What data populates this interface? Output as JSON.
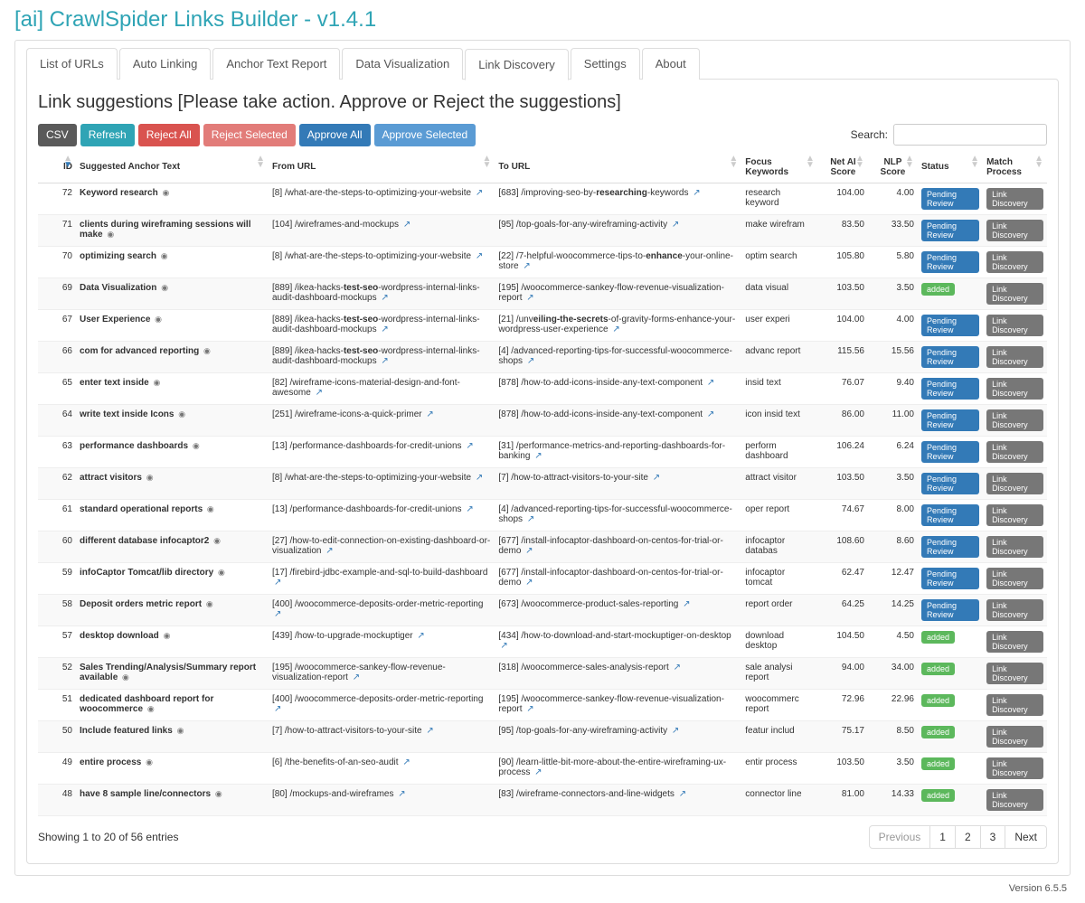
{
  "app_title": "[ai] CrawlSpider Links Builder - v1.4.1",
  "version": "Version 6.5.5",
  "tabs": [
    "List of URLs",
    "Auto Linking",
    "Anchor Text Report",
    "Data Visualization",
    "Link Discovery",
    "Settings",
    "About"
  ],
  "active_tab": 4,
  "panel_heading": "Link suggestions [Please take action. Approve or Reject the suggestions]",
  "buttons": {
    "csv": "CSV",
    "refresh": "Refresh",
    "reject_all": "Reject All",
    "reject_sel": "Reject Selected",
    "approve_all": "Approve All",
    "approve_sel": "Approve Selected"
  },
  "search_label": "Search:",
  "search_value": "",
  "columns": [
    "ID",
    "Suggested Anchor Text",
    "From URL",
    "To URL",
    "Focus Keywords",
    "Net AI Score",
    "NLP Score",
    "Status",
    "Match Process"
  ],
  "status_labels": {
    "pending": "Pending Review",
    "added": "added"
  },
  "match_label": "Link Discovery",
  "rows": [
    {
      "id": 72,
      "anchor": "Keyword research",
      "from_pre": "[8] /what-are-the-steps-to-optimizing-your-website",
      "from_bold": "",
      "to_pre": "[683] /improving-seo-by-",
      "to_bold": "researching",
      "to_post": "-keywords",
      "kw": "research keyword",
      "net": "104.00",
      "nlp": "4.00",
      "status": "pending"
    },
    {
      "id": 71,
      "anchor": "clients during wireframing sessions will make",
      "from_pre": "[104] /wireframes-and-mockups",
      "from_bold": "",
      "to_pre": "[95] /top-goals-for-any-wireframing-activity",
      "to_bold": "",
      "to_post": "",
      "kw": "make wirefram",
      "net": "83.50",
      "nlp": "33.50",
      "status": "pending"
    },
    {
      "id": 70,
      "anchor": "optimizing search",
      "from_pre": "[8] /what-are-the-steps-to-optimizing-your-website",
      "from_bold": "",
      "to_pre": "[22] /7-helpful-woocommerce-tips-to-",
      "to_bold": "enhance",
      "to_post": "-your-online-store",
      "kw": "optim search",
      "net": "105.80",
      "nlp": "5.80",
      "status": "pending"
    },
    {
      "id": 69,
      "anchor": "Data Visualization",
      "from_pre": "[889] /ikea-hacks-",
      "from_bold": "test-seo",
      "from_post": "-wordpress-internal-links-audit-dashboard-mockups",
      "to_pre": "[195] /woocommerce-sankey-flow-revenue-visualization-report",
      "to_bold": "",
      "to_post": "",
      "kw": "data visual",
      "net": "103.50",
      "nlp": "3.50",
      "status": "added"
    },
    {
      "id": 67,
      "anchor": "User Experience",
      "from_pre": "[889] /ikea-hacks-",
      "from_bold": "test-seo",
      "from_post": "-wordpress-internal-links-audit-dashboard-mockups",
      "to_pre": "[21] /unv",
      "to_bold": "eiling-the-secrets",
      "to_post": "-of-gravity-forms-enhance-your-wordpress-user-experience",
      "kw": "user experi",
      "net": "104.00",
      "nlp": "4.00",
      "status": "pending"
    },
    {
      "id": 66,
      "anchor": "com for advanced reporting",
      "from_pre": "[889] /ikea-hacks-",
      "from_bold": "test-seo",
      "from_post": "-wordpress-internal-links-audit-dashboard-mockups",
      "to_pre": "[4] /advanced-reporting-tips-for-successful-woocommerce-shops",
      "to_bold": "",
      "to_post": "",
      "kw": "advanc report",
      "net": "115.56",
      "nlp": "15.56",
      "status": "pending"
    },
    {
      "id": 65,
      "anchor": "enter text inside",
      "from_pre": "[82] /wireframe-icons-material-design-and-font-awesome",
      "from_bold": "",
      "to_pre": "[878] /how-to-add-icons-inside-any-text-component",
      "to_bold": "",
      "to_post": "",
      "kw": "insid text",
      "net": "76.07",
      "nlp": "9.40",
      "status": "pending"
    },
    {
      "id": 64,
      "anchor": "write text inside Icons",
      "from_pre": "[251] /wireframe-icons-a-quick-primer",
      "from_bold": "",
      "to_pre": "[878] /how-to-add-icons-inside-any-text-component",
      "to_bold": "",
      "to_post": "",
      "kw": "icon insid text",
      "net": "86.00",
      "nlp": "11.00",
      "status": "pending"
    },
    {
      "id": 63,
      "anchor": "performance dashboards",
      "from_pre": "[13] /performance-dashboards-for-credit-unions",
      "from_bold": "",
      "to_pre": "[31] /performance-metrics-and-reporting-dashboards-for-banking",
      "to_bold": "",
      "to_post": "",
      "kw": "perform dashboard",
      "net": "106.24",
      "nlp": "6.24",
      "status": "pending"
    },
    {
      "id": 62,
      "anchor": "attract visitors",
      "from_pre": "[8] /what-are-the-steps-to-optimizing-your-website",
      "from_bold": "",
      "to_pre": "[7] /how-to-attract-visitors-to-your-site",
      "to_bold": "",
      "to_post": "",
      "kw": "attract visitor",
      "net": "103.50",
      "nlp": "3.50",
      "status": "pending"
    },
    {
      "id": 61,
      "anchor": "standard operational reports",
      "from_pre": "[13] /performance-dashboards-for-credit-unions",
      "from_bold": "",
      "to_pre": "[4] /advanced-reporting-tips-for-successful-woocommerce-shops",
      "to_bold": "",
      "to_post": "",
      "kw": "oper report",
      "net": "74.67",
      "nlp": "8.00",
      "status": "pending"
    },
    {
      "id": 60,
      "anchor": "different database infocaptor2",
      "from_pre": "[27] /how-to-edit-connection-on-existing-dashboard-or-visualization",
      "from_bold": "",
      "to_pre": "[677] /install-infocaptor-dashboard-on-centos-for-trial-or-demo",
      "to_bold": "",
      "to_post": "",
      "kw": "infocaptor databas",
      "net": "108.60",
      "nlp": "8.60",
      "status": "pending"
    },
    {
      "id": 59,
      "anchor": "infoCaptor Tomcat/lib directory",
      "from_pre": "[17] /firebird-jdbc-example-and-sql-to-build-dashboard",
      "from_bold": "",
      "to_pre": "[677] /install-infocaptor-dashboard-on-centos-for-trial-or-demo",
      "to_bold": "",
      "to_post": "",
      "kw": "infocaptor tomcat",
      "net": "62.47",
      "nlp": "12.47",
      "status": "pending"
    },
    {
      "id": 58,
      "anchor": "Deposit orders metric report",
      "from_pre": "[400] /woocommerce-deposits-order-metric-reporting",
      "from_bold": "",
      "to_pre": "[673] /woocommerce-product-sales-reporting",
      "to_bold": "",
      "to_post": "",
      "kw": "report order",
      "net": "64.25",
      "nlp": "14.25",
      "status": "pending"
    },
    {
      "id": 57,
      "anchor": "desktop download",
      "from_pre": "[439] /how-to-upgrade-mockuptiger",
      "from_bold": "",
      "to_pre": "[434] /how-to-download-and-start-mockuptiger-on-desktop",
      "to_bold": "",
      "to_post": "",
      "kw": "download desktop",
      "net": "104.50",
      "nlp": "4.50",
      "status": "added"
    },
    {
      "id": 52,
      "anchor": "Sales Trending/Analysis/Summary report available",
      "from_pre": "[195] /woocommerce-sankey-flow-revenue-visualization-report",
      "from_bold": "",
      "to_pre": "[318] /woocommerce-sales-analysis-report",
      "to_bold": "",
      "to_post": "",
      "kw": "sale analysi report",
      "net": "94.00",
      "nlp": "34.00",
      "status": "added"
    },
    {
      "id": 51,
      "anchor": "dedicated dashboard report for woocommerce",
      "from_pre": "[400] /woocommerce-deposits-order-metric-reporting",
      "from_bold": "",
      "to_pre": "[195] /woocommerce-sankey-flow-revenue-visualization-report",
      "to_bold": "",
      "to_post": "",
      "kw": "woocommerc report",
      "net": "72.96",
      "nlp": "22.96",
      "status": "added"
    },
    {
      "id": 50,
      "anchor": "Include featured links",
      "from_pre": "[7] /how-to-attract-visitors-to-your-site",
      "from_bold": "",
      "to_pre": "[95] /top-goals-for-any-wireframing-activity",
      "to_bold": "",
      "to_post": "",
      "kw": "featur includ",
      "net": "75.17",
      "nlp": "8.50",
      "status": "added"
    },
    {
      "id": 49,
      "anchor": "entire process",
      "from_pre": "[6] /the-benefits-of-an-seo-audit",
      "from_bold": "",
      "to_pre": "[90] /learn-little-bit-more-about-the-entire-wireframing-ux-process",
      "to_bold": "",
      "to_post": "",
      "kw": "entir process",
      "net": "103.50",
      "nlp": "3.50",
      "status": "added"
    },
    {
      "id": 48,
      "anchor": "have 8 sample line/connectors",
      "from_pre": "[80] /mockups-and-wireframes",
      "from_bold": "",
      "to_pre": "[83] /wireframe-connectors-and-line-widgets",
      "to_bold": "",
      "to_post": "",
      "kw": "connector line",
      "net": "81.00",
      "nlp": "14.33",
      "status": "added"
    }
  ],
  "info_text": "Showing 1 to 20 of 56 entries",
  "pager": {
    "previous": "Previous",
    "pages": [
      "1",
      "2",
      "3"
    ],
    "next": "Next",
    "active": 0
  }
}
